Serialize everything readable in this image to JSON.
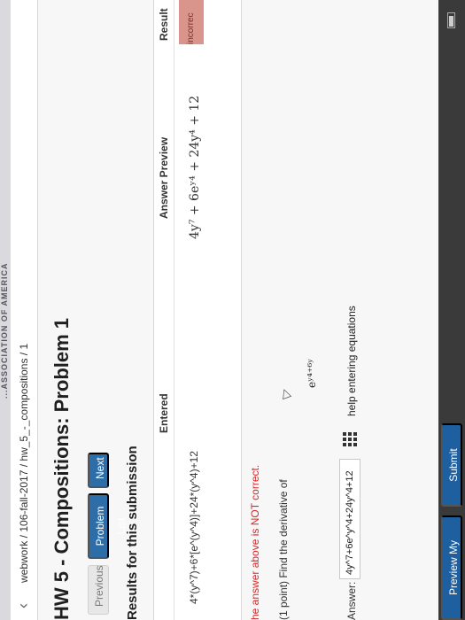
{
  "system_bar": {
    "text": "...ASSOCIATION OF AMERICA"
  },
  "browser": {
    "breadcrumb": "webwork / 106-fall-2017 / hw_5_-_compositions / 1"
  },
  "page": {
    "title": "HW 5 - Compositions: Problem 1",
    "buttons": {
      "previous": "Previous",
      "problem_list": "Problem List",
      "next": "Next"
    },
    "results_title": "Results for this submission",
    "table": {
      "headers": [
        "Entered",
        "Answer Preview",
        "Result"
      ],
      "rows": [
        {
          "entered": "4*(y^7)+6*[e^(y^4)]+24*(y^4)+12",
          "preview": "4y⁷ + 6eʸ⁴ + 24y⁴ + 12",
          "result": "incorrec"
        }
      ]
    },
    "notice": "he answer above is NOT correct.",
    "prompt": "(1 point) Find the derivative of",
    "equation": "eʸ⁴⁺⁶ʸ",
    "answer_label": "Answer:",
    "answer_value": "4y^7+6e^y^4+24y^4+12",
    "help_text": "help entering equations"
  },
  "footer": {
    "preview": "Preview My Answers",
    "submit": "Submit Answers"
  }
}
